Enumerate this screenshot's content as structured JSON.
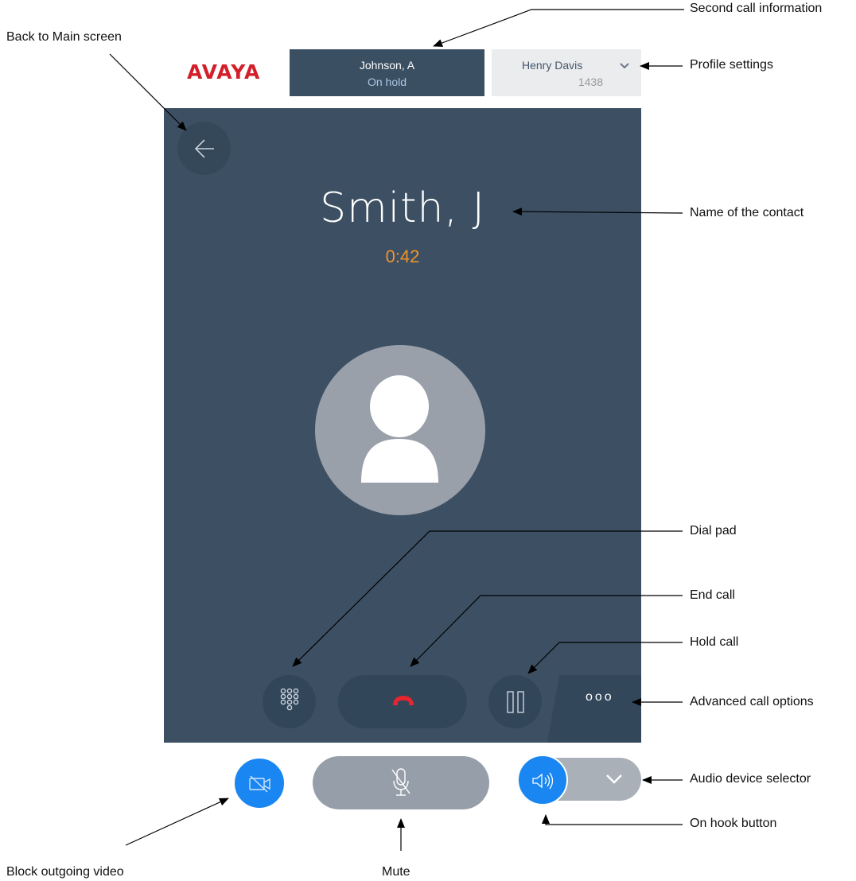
{
  "header": {
    "logo": "AVAYA",
    "held_call": {
      "name": "Johnson, A",
      "status": "On hold"
    },
    "profile": {
      "name": "Henry Davis",
      "extension": "1438"
    }
  },
  "call": {
    "contact_name": "Smith, J",
    "duration": "0:42"
  },
  "controls": {
    "more_options_label": "ooo"
  },
  "annotations": {
    "second_call": "Second call information",
    "back": "Back to Main screen",
    "profile": "Profile settings",
    "contact_name": "Name of the contact",
    "dial_pad": "Dial pad",
    "end_call": "End call",
    "hold_call": "Hold call",
    "advanced": "Advanced call options",
    "audio_selector": "Audio device selector",
    "on_hook": "On hook button",
    "block_video": "Block outgoing video",
    "mute": "Mute"
  },
  "colors": {
    "brand": "#d21f2a",
    "panel": "#3d5063",
    "timer": "#f0922c",
    "accent": "#1a86f2",
    "end_call": "#e8242f"
  },
  "icons": {
    "back": "arrow-left-icon",
    "profile_menu": "chevron-down-icon",
    "avatar": "person-icon",
    "dial_pad": "dialpad-icon",
    "end_call": "phone-hangup-icon",
    "hold": "pause-icon",
    "video": "video-off-icon",
    "mute": "microphone-off-icon",
    "speaker": "speaker-icon",
    "audio_menu": "chevron-down-icon"
  }
}
